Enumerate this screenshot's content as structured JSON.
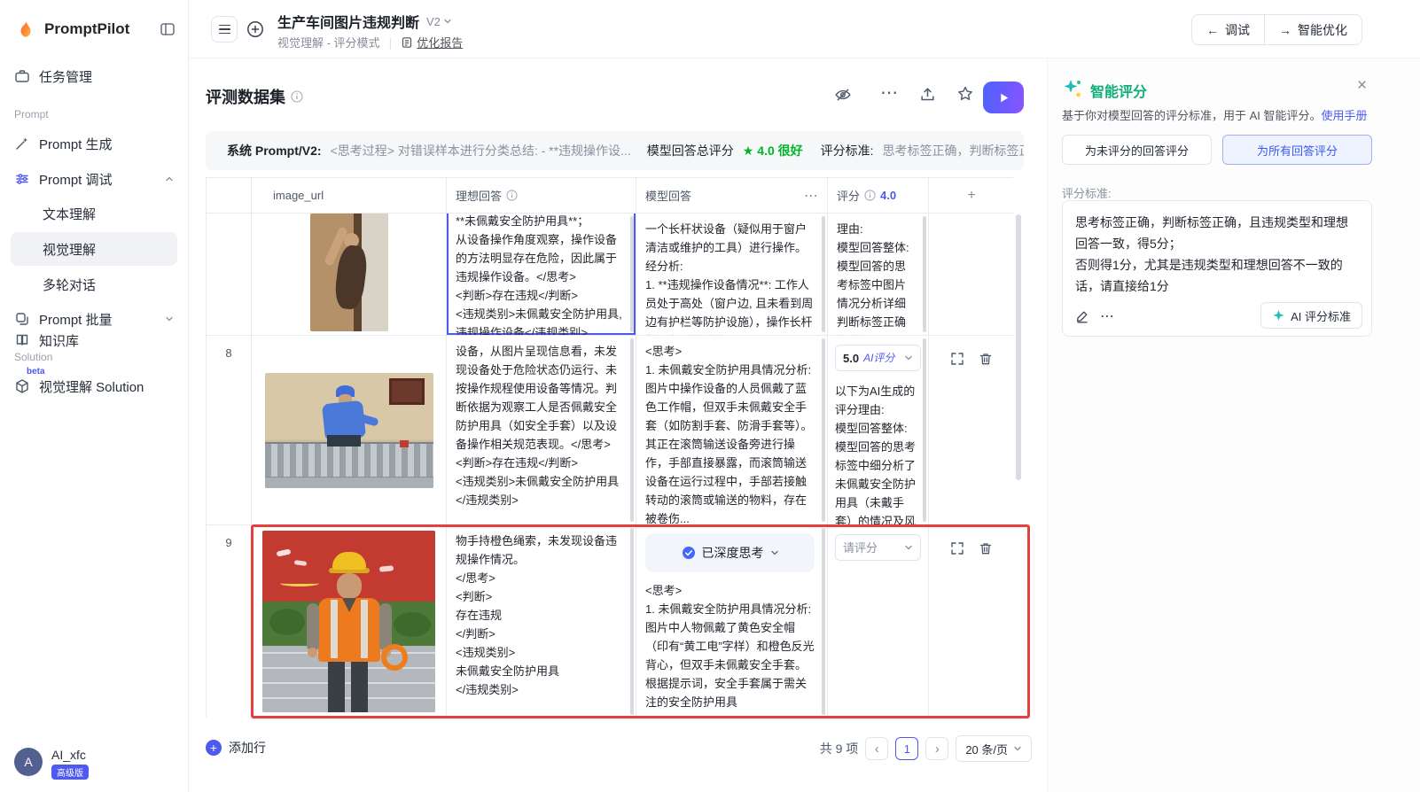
{
  "colors": {
    "accent": "#4d59ef",
    "success_green": "#00b42a",
    "highlight_red": "#e5403d",
    "ai_green": "#0fae77"
  },
  "sidebar": {
    "logo": "PromptPilot",
    "task": "任务管理",
    "section_prompt": "Prompt",
    "gen": "Prompt 生成",
    "debug": "Prompt 调试",
    "debug_children": [
      "文本理解",
      "视觉理解",
      "多轮对话"
    ],
    "batch": "Prompt 批量",
    "section_solution": "Solution",
    "solution": "视觉理解 Solution",
    "solution_badge": "beta",
    "knowledge": "知识库",
    "user_name": "AI_xfc",
    "user_badge": "高级版",
    "avatar": "A"
  },
  "header": {
    "title": "生产车间图片违规判断",
    "version": "V2",
    "mode": "视觉理解 - 评分模式",
    "report": "优化报告",
    "debug_btn": "调试",
    "optimize_btn": "智能优化"
  },
  "dataset": {
    "title": "评测数据集",
    "system_label": "系统 Prompt/V2:",
    "system_text": "<思考过程> 对错误样本进行分类总结: - **违规操作设...",
    "score_label": "模型回答总评分",
    "score_value": "4.0 很好",
    "criteria_label": "评分标准:",
    "criteria_text": "思考标签正确，判断标签正...",
    "add_row": "添加行",
    "total": "共 9 项",
    "page": "1",
    "page_size": "20 条/页"
  },
  "table": {
    "col_image": "image_url",
    "col_ideal": "理想回答",
    "col_model": "模型回答",
    "col_score": "评分",
    "col_score_value": "4.0",
    "col_add": "+",
    "row7": {
      "ideal": "**未佩戴安全防护用具**；\n从设备操作角度观察，操作设备的方法明显存在危险，因此属于违规操作设备。</思考>\n<判断>存在违规</判断>\n<违规类别>未佩戴安全防护用具, 违规操作设备</违规类别>",
      "model": "一个长杆状设备（疑似用于窗户清洁或维护的工具）进行操作。经分析:\n1. **违规操作设备情况**: 工作人员处于高处（窗户边, 且未看到周边有护栏等防护设施），操作长杆状设备时身体部...",
      "score_reason": "理由:\n模型回答整体: 模型回答的思考标签中图片情况分析详细判断标签正确为存在违规, 违规类型与"
    },
    "row8": {
      "num": "8",
      "ideal": "设备，从图片呈现信息看，未发现设备处于危险状态仍运行、未按操作规程使用设备等情况。判断依据为观察工人是否佩戴安全防护用具（如安全手套）以及设备操作相关规范表现。</思考>\n<判断>存在违规</判断>\n<违规类别>未佩戴安全防护用具</违规类别>",
      "model": "<思考>\n1. 未佩戴安全防护用具情况分析: 图片中操作设备的人员佩戴了蓝色工作帽，但双手未佩戴安全手套（如防割手套、防滑手套等）。其正在滚筒输送设备旁进行操作，手部直接暴露，而滚筒输送设备在运行过程中，手部若接触转动的滚筒或输送的物料，存在被卷伤...",
      "score": "5.0",
      "score_tag": "AI评分",
      "score_reason": "以下为AI生成的评分理由:\n模型回答整体: 模型回答的思考标签中细分析了未佩戴安全防护用具（未戴手套）的情况及风险"
    },
    "row9": {
      "num": "9",
      "ideal": "物手持橙色绳索，未发现设备违规操作情况。\n</思考>\n<判断>\n存在违规\n</判断>\n<违规类别>\n未佩戴安全防护用具\n</违规类别>",
      "model_badge": "已深度思考",
      "model": "<思考>\n1. 未佩戴安全防护用具情况分析: 图片中人物佩戴了黄色安全帽（印有“黄工电”字样）和橙色反光背心，但双手未佩戴安全手套。根据提示词，安全手套属于需关注的安全防护用具",
      "score_placeholder": "请评分"
    }
  },
  "panel": {
    "title": "智能评分",
    "desc": "基于你对模型回答的评分标准，用于 AI 智能评分。",
    "manual": "使用手册",
    "btn_unscored": "为未评分的回答评分",
    "btn_all": "为所有回答评分",
    "criteria_label": "评分标准:",
    "criteria": "思考标签正确，判断标签正确，且违规类型和理想回答一致，得5分；\n否则得1分，尤其是违规类型和理想回答不一致的话，请直接给1分",
    "more": "⋯",
    "ai_btn": "AI 评分标准"
  }
}
